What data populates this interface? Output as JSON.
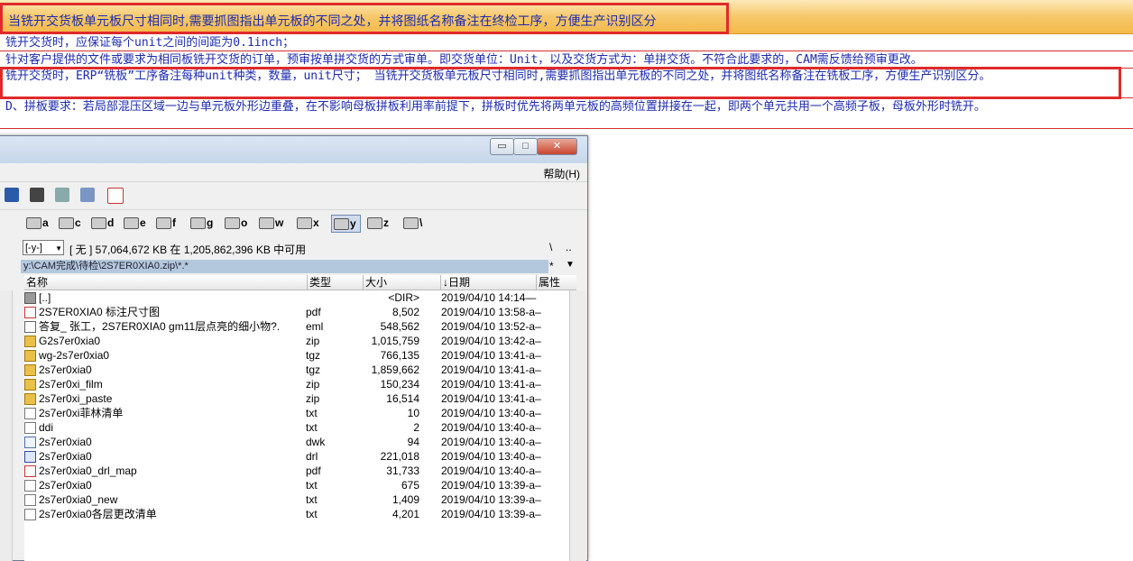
{
  "doc": {
    "banner": "当铣开交货板单元板尺寸相同时,需要抓图指出单元板的不同之处，并将图纸名称备注在终检工序，方便生产识别区分",
    "line1": "铣开交货时，应保证每个unit之间的间距为0.1inch；",
    "line2": "针对客户提供的文件或要求为相同板铣开交货的订单，预审按单拼交货的方式审单。即交货单位：Unit，以及交货方式为：单拼交货。不符合此要求的，CAM需反馈给预审更改。",
    "line3": "铣开交货时，ERP“铣板”工序备注每种unit种类，数量，unit尺寸； 当铣开交货板单元板尺寸相同时,需要抓图指出单元板的不同之处，并将图纸名称备注在铣板工序，方便生产识别区分。",
    "line4": "D、拼板要求：若局部混压区域一边与单元板外形边重叠，在不影响母板拼板利用率前提下，拼板时优先将两单元板的高频位置拼接在一起，即两个单元共用一个高频子板，母板外形时铣开。"
  },
  "window": {
    "min_label": "▭",
    "max_label": "□",
    "close_label": "✕",
    "help_menu": "帮助(H)",
    "drives": [
      "a",
      "c",
      "d",
      "e",
      "f",
      "g",
      "o",
      "w",
      "x",
      "y",
      "z",
      "\\"
    ],
    "drive_select": "[-y-]",
    "space_info": "[ 无 ]  57,064,672 KB 在 1,205,862,396 KB 中可用",
    "backslash_btn": "\\",
    "dots_btn": "..",
    "path": "y:\\CAM完成\\待检\\2S7ER0XIA0.zip\\*.*",
    "path_star": "*",
    "path_drop": "▼",
    "columns": {
      "name": "名称",
      "type": "类型",
      "size": "大小",
      "date": "↓日期",
      "attr": "属性"
    },
    "files": [
      {
        "icon": "up",
        "name": "[..]",
        "type": "",
        "size": "<DIR>",
        "date": "2019/04/10 14:14—"
      },
      {
        "icon": "pdf",
        "name": "2S7ER0XIA0  标注尺寸图",
        "type": "pdf",
        "size": "8,502",
        "date": "2019/04/10 13:58-a–"
      },
      {
        "icon": "eml",
        "name": "答复_ 张工，2S7ER0XIA0  gm11层点亮的细小物?.",
        "type": "eml",
        "size": "548,562",
        "date": "2019/04/10 13:52-a–"
      },
      {
        "icon": "zip",
        "name": "G2s7er0xia0",
        "type": "zip",
        "size": "1,015,759",
        "date": "2019/04/10 13:42-a–"
      },
      {
        "icon": "zip",
        "name": "wg-2s7er0xia0",
        "type": "tgz",
        "size": "766,135",
        "date": "2019/04/10 13:41-a–"
      },
      {
        "icon": "zip",
        "name": "2s7er0xia0",
        "type": "tgz",
        "size": "1,859,662",
        "date": "2019/04/10 13:41-a–"
      },
      {
        "icon": "zip",
        "name": "2s7er0xi_film",
        "type": "zip",
        "size": "150,234",
        "date": "2019/04/10 13:41-a–"
      },
      {
        "icon": "zip",
        "name": "2s7er0xi_paste",
        "type": "zip",
        "size": "16,514",
        "date": "2019/04/10 13:41-a–"
      },
      {
        "icon": "txt",
        "name": "2s7er0xi菲林清单",
        "type": "txt",
        "size": "10",
        "date": "2019/04/10 13:40-a–"
      },
      {
        "icon": "txt",
        "name": "ddi",
        "type": "txt",
        "size": "2",
        "date": "2019/04/10 13:40-a–"
      },
      {
        "icon": "dwk",
        "name": "2s7er0xia0",
        "type": "dwk",
        "size": "94",
        "date": "2019/04/10 13:40-a–"
      },
      {
        "icon": "drl",
        "name": "2s7er0xia0",
        "type": "drl",
        "size": "221,018",
        "date": "2019/04/10 13:40-a–"
      },
      {
        "icon": "pdf",
        "name": "2s7er0xia0_drl_map",
        "type": "pdf",
        "size": "31,733",
        "date": "2019/04/10 13:40-a–"
      },
      {
        "icon": "txt",
        "name": "2s7er0xia0",
        "type": "txt",
        "size": "675",
        "date": "2019/04/10 13:39-a–"
      },
      {
        "icon": "txt",
        "name": "2s7er0xia0_new",
        "type": "txt",
        "size": "1,409",
        "date": "2019/04/10 13:39-a–"
      },
      {
        "icon": "txt",
        "name": "2s7er0xia0各层更改清单",
        "type": "txt",
        "size": "4,201",
        "date": "2019/04/10 13:39-a–"
      }
    ]
  },
  "colors": {
    "highlight": "#e02a2a",
    "doc_text": "#1d2bb0",
    "banner": "#f6c86a"
  }
}
